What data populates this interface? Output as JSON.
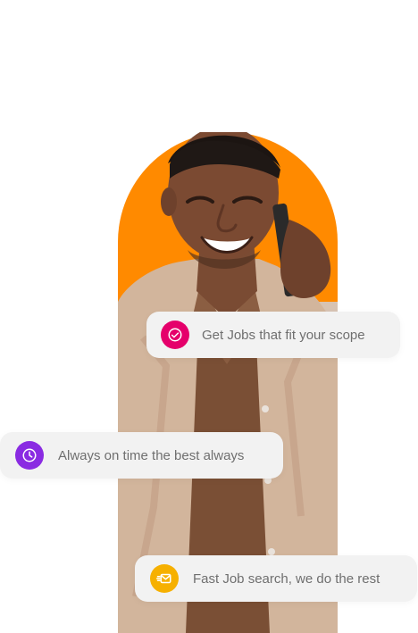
{
  "hero": {
    "image_alt": "Smiling man talking on a phone",
    "arch_color": "#ff8a00"
  },
  "features": [
    {
      "label": "Get Jobs that fit your scope",
      "icon": "check-circle-icon",
      "icon_bg": "#e5006b"
    },
    {
      "label": "Always on time the best always",
      "icon": "clock-icon",
      "icon_bg": "#8a2be2"
    },
    {
      "label": "Fast Job search, we do the rest",
      "icon": "fast-mail-icon",
      "icon_bg": "#f6b000"
    }
  ]
}
